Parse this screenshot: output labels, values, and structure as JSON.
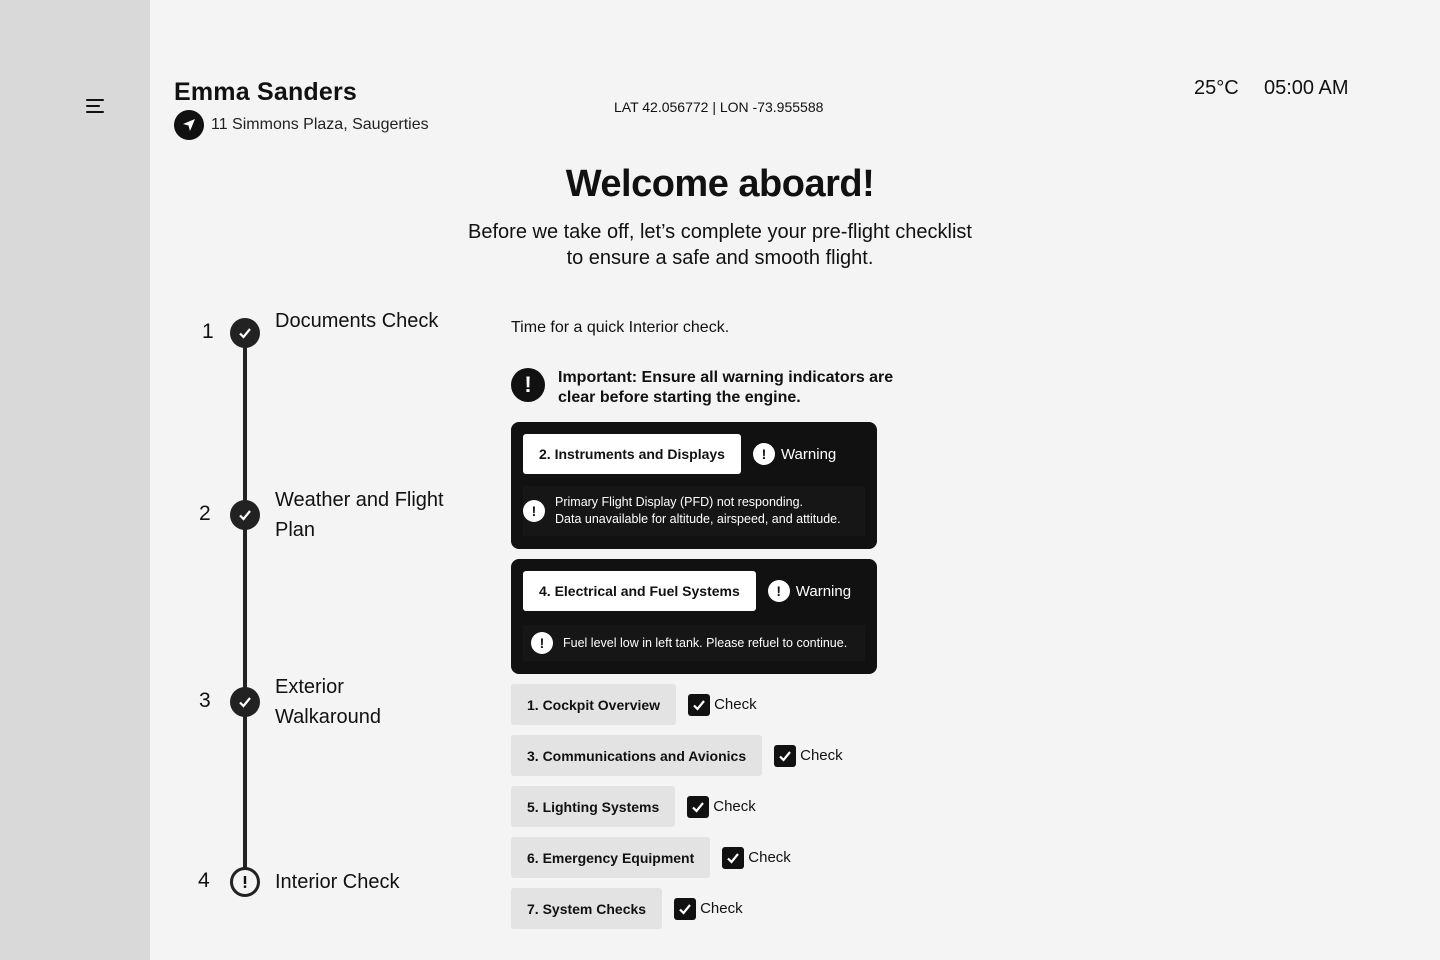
{
  "header": {
    "user_name": "Emma Sanders",
    "location": "11 Simmons Plaza, Saugerties",
    "coordinates": "LAT 42.056772 | LON -73.955588",
    "temperature": "25°C",
    "time": "05:00 AM"
  },
  "hero": {
    "title": "Welcome aboard!",
    "subtitle_line1": "Before we take off, let’s complete your pre-flight checklist",
    "subtitle_line2": "to ensure a safe and smooth flight."
  },
  "steps": [
    {
      "number": "1",
      "label": "Documents Check",
      "status": "complete"
    },
    {
      "number": "2",
      "label": "Weather and Flight Plan",
      "status": "complete"
    },
    {
      "number": "3",
      "label": "Exterior Walkaround",
      "status": "complete"
    },
    {
      "number": "4",
      "label": "Interior Check",
      "status": "warning"
    }
  ],
  "main": {
    "intro": "Time for a quick Interior check.",
    "important": "Important: Ensure all warning indicators are clear before starting the engine.",
    "warnings": [
      {
        "title": "2. Instruments and Displays",
        "status": "Warning",
        "message_line1": "Primary Flight Display (PFD) not responding.",
        "message_line2": "Data unavailable for altitude, airspeed, and attitude."
      },
      {
        "title": "4. Electrical and Fuel Systems",
        "status": "Warning",
        "message_line1": "Fuel level low in left tank. Please refuel to continue."
      }
    ],
    "checks": [
      {
        "title": "1. Cockpit Overview",
        "status": "Check"
      },
      {
        "title": "3. Communications and Avionics",
        "status": "Check"
      },
      {
        "title": "5. Lighting Systems",
        "status": "Check"
      },
      {
        "title": "6. Emergency Equipment",
        "status": "Check"
      },
      {
        "title": "7. System Checks",
        "status": "Check"
      }
    ]
  },
  "colors": {
    "sidebar": "#d9d9d9",
    "background": "#f4f4f4",
    "dark": "#111111"
  }
}
